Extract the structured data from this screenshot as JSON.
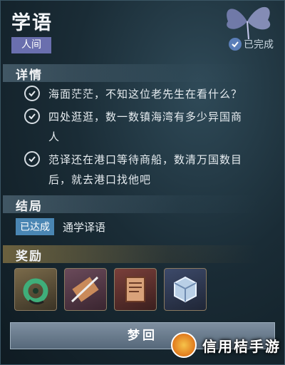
{
  "header": {
    "title": "学语",
    "category_tag": "人间",
    "status_label": "已完成"
  },
  "details": {
    "section_label": "详情",
    "tasks": [
      {
        "text_line1": "海面茫茫，不知这位老先生在看什么？",
        "text_line2": "",
        "completed": true
      },
      {
        "text_line1": "四处逛逛，数一数镇海湾有多少异国商",
        "text_line2": "人",
        "completed": true
      },
      {
        "text_line1": "范译还在港口等待商船，数清万国数目",
        "text_line2": "后，就去港口找他吧",
        "completed": true
      }
    ]
  },
  "ending": {
    "section_label": "结局",
    "badge": "已达成",
    "text": "通学译语"
  },
  "rewards": {
    "section_label": "奖励",
    "items": [
      {
        "icon": "jade-pendant-icon"
      },
      {
        "icon": "weapon-scroll-icon"
      },
      {
        "icon": "book-icon"
      },
      {
        "icon": "crystal-cube-icon"
      }
    ]
  },
  "action_button": {
    "label": "梦回"
  },
  "watermark": {
    "text": "信用桔手游"
  },
  "colors": {
    "tag_bg": "#6a6fae",
    "badge_bg": "#4a86b3",
    "button_bg": "#6b7d8f"
  }
}
